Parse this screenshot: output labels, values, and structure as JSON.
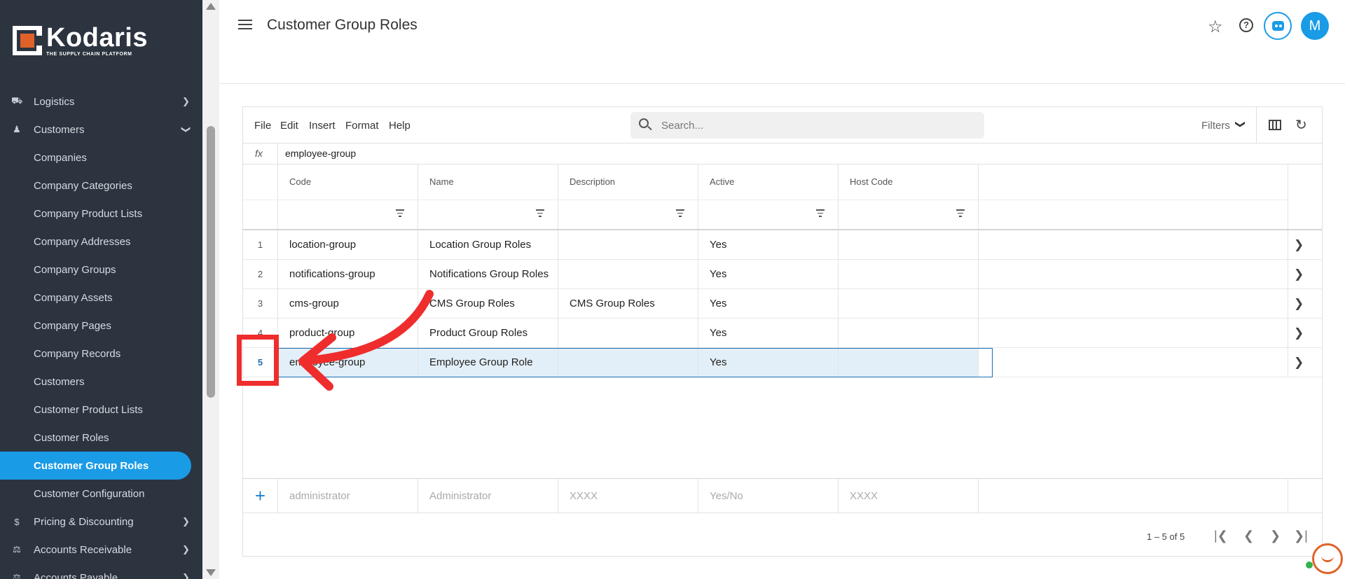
{
  "brand": {
    "name": "Kodaris",
    "tagline": "THE SUPPLY CHAIN PLATFORM",
    "accent": "#e0622a"
  },
  "sidebar": {
    "items": [
      {
        "label": "Logistics",
        "icon": "truck-icon",
        "expanded": false
      },
      {
        "label": "Customers",
        "icon": "users-icon",
        "expanded": true
      },
      {
        "label": "Pricing & Discounting",
        "icon": "dollar-icon",
        "expanded": false
      },
      {
        "label": "Accounts Receivable",
        "icon": "bank-icon",
        "expanded": false
      },
      {
        "label": "Accounts Payable",
        "icon": "bank-icon",
        "expanded": false
      }
    ],
    "customers_sub": [
      "Companies",
      "Company Categories",
      "Company Product Lists",
      "Company Addresses",
      "Company Groups",
      "Company Assets",
      "Company Pages",
      "Company Records",
      "Customers",
      "Customer Product Lists",
      "Customer Roles",
      "Customer Group Roles",
      "Customer Configuration"
    ],
    "active_item": "Customer Group Roles",
    "active_color": "#1a9be6"
  },
  "header": {
    "title": "Customer Group Roles",
    "avatar_initial": "M"
  },
  "toolbar": {
    "menus": [
      "File",
      "Edit",
      "Insert",
      "Format",
      "Help"
    ],
    "search_placeholder": "Search...",
    "filters_label": "Filters"
  },
  "formula_bar": {
    "fx": "fx",
    "value": "employee-group"
  },
  "table": {
    "columns": [
      "Code",
      "Name",
      "Description",
      "Active",
      "Host Code"
    ],
    "rows": [
      {
        "num": "1",
        "code": "location-group",
        "name": "Location Group Roles",
        "description": "",
        "active": "Yes",
        "host_code": ""
      },
      {
        "num": "2",
        "code": "notifications-group",
        "name": "Notifications Group Roles",
        "description": "",
        "active": "Yes",
        "host_code": ""
      },
      {
        "num": "3",
        "code": "cms-group",
        "name": "CMS Group Roles",
        "description": "CMS Group Roles",
        "active": "Yes",
        "host_code": ""
      },
      {
        "num": "4",
        "code": "product-group",
        "name": "Product Group Roles",
        "description": "",
        "active": "Yes",
        "host_code": ""
      },
      {
        "num": "5",
        "code": "employee-group",
        "name": "Employee Group Role",
        "description": "",
        "active": "Yes",
        "host_code": ""
      }
    ],
    "selected_row": 5,
    "new_row_placeholders": {
      "code": "administrator",
      "name": "Administrator",
      "description": "XXXX",
      "active": "Yes/No",
      "host_code": "XXXX"
    }
  },
  "pagination": {
    "range": "1 – 5 of 5"
  },
  "annotation": {
    "color": "#ef2d2d"
  }
}
